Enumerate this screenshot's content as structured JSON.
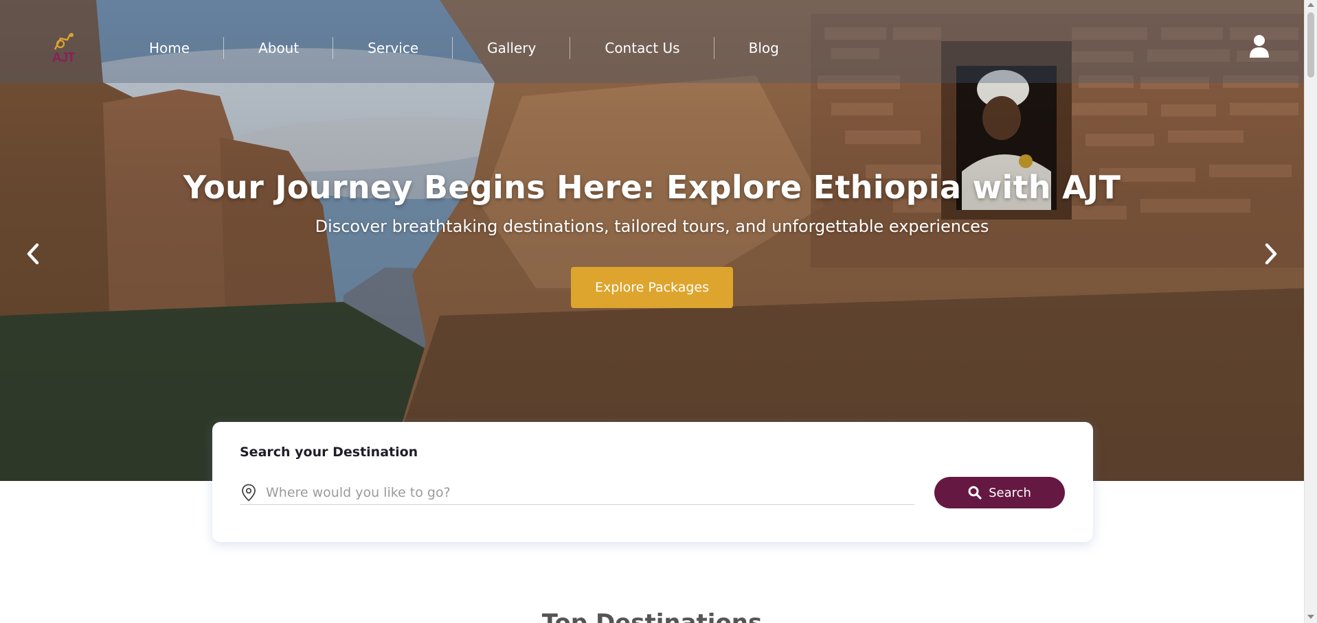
{
  "nav": {
    "logo_text": "AJT",
    "items": [
      {
        "label": "Home"
      },
      {
        "label": "About"
      },
      {
        "label": "Service"
      },
      {
        "label": "Gallery"
      },
      {
        "label": "Contact Us"
      },
      {
        "label": "Blog"
      }
    ],
    "user_icon": "user-icon"
  },
  "hero": {
    "title": "Your Journey Begins Here: Explore Ethiopia with AJT",
    "subtitle": "Discover breathtaking destinations, tailored tours, and unforgettable experiences",
    "cta_label": "Explore Packages",
    "prev_icon": "chevron-left-icon",
    "next_icon": "chevron-right-icon"
  },
  "search": {
    "heading": "Search your Destination",
    "placeholder": "Where would you like to go?",
    "value": "",
    "button_label": "Search",
    "button_icon": "search-icon",
    "field_icon": "map-pin-icon"
  },
  "section": {
    "title": "Top Destinations"
  },
  "colors": {
    "accent_gold": "#dda52e",
    "brand_plum": "#651842",
    "logo_plum": "#8a1f5a"
  }
}
